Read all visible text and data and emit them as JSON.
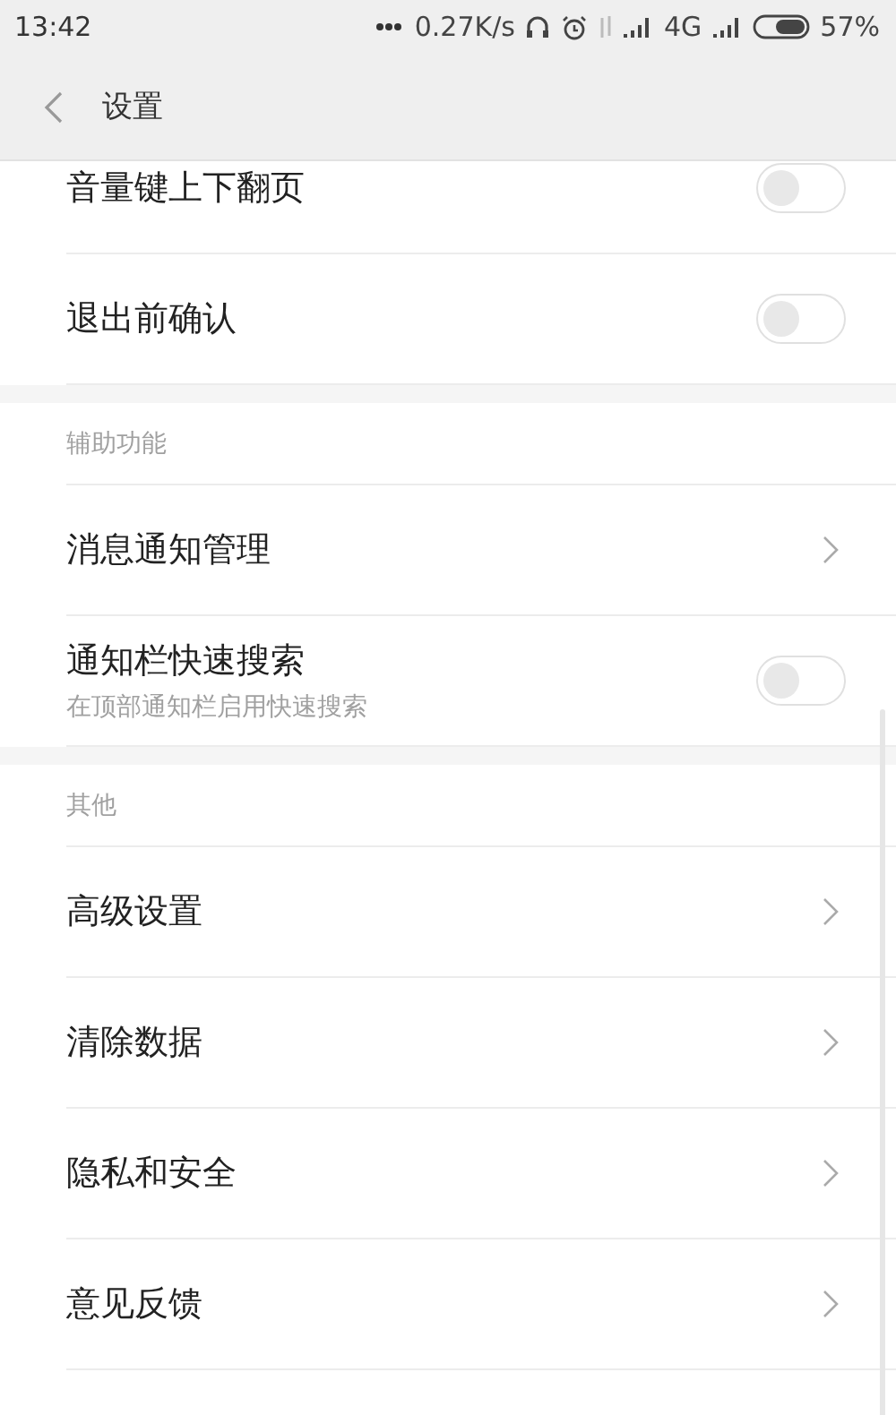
{
  "status_bar": {
    "time": "13:42",
    "speed": "0.27K/s",
    "network": "4G",
    "battery": "57%"
  },
  "header": {
    "title": "设置"
  },
  "sections": [
    {
      "items": [
        {
          "kind": "toggle",
          "label": "音量键上下翻页",
          "on": false
        },
        {
          "kind": "toggle",
          "label": "退出前确认",
          "on": false
        }
      ]
    },
    {
      "title": "辅助功能",
      "items": [
        {
          "kind": "link",
          "label": "消息通知管理"
        },
        {
          "kind": "toggle",
          "label": "通知栏快速搜索",
          "subtitle": "在顶部通知栏启用快速搜索",
          "on": false
        }
      ]
    },
    {
      "title": "其他",
      "items": [
        {
          "kind": "link",
          "label": "高级设置"
        },
        {
          "kind": "link",
          "label": "清除数据"
        },
        {
          "kind": "link",
          "label": "隐私和安全"
        },
        {
          "kind": "link",
          "label": "意见反馈"
        }
      ]
    }
  ]
}
